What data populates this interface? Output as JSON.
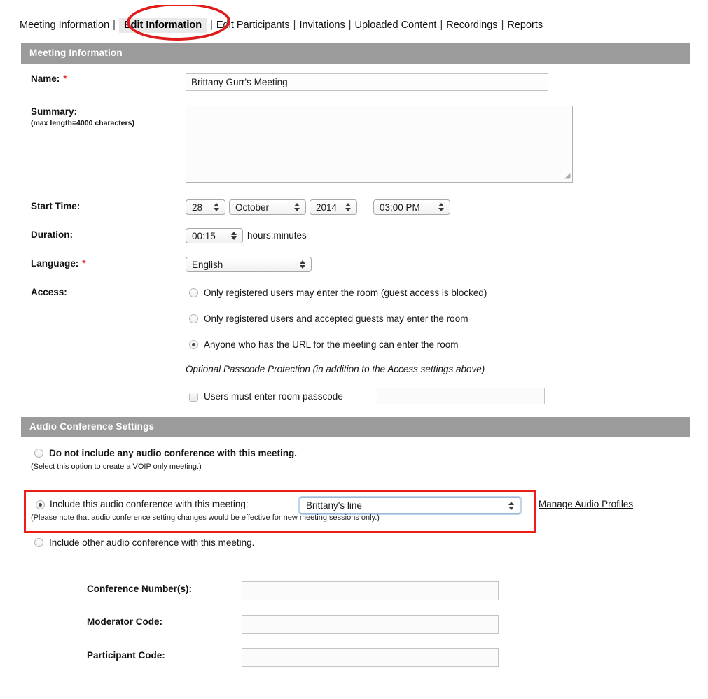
{
  "nav": {
    "separator": "|",
    "tabs": [
      {
        "label": "Meeting Information",
        "active": false
      },
      {
        "label": "Edit Information",
        "active": true
      },
      {
        "label": "Edit Participants",
        "active": false
      },
      {
        "label": "Invitations",
        "active": false
      },
      {
        "label": "Uploaded Content",
        "active": false
      },
      {
        "label": "Recordings",
        "active": false
      },
      {
        "label": "Reports",
        "active": false
      }
    ]
  },
  "annotations": {
    "ellipse_target": "Edit Information",
    "ellipse_color": "#e01b1b",
    "redbox_color": "#ee1c17",
    "redbox_target": "Include this audio conference with this meeting"
  },
  "colors": {
    "section_bar": "#9b9b9b",
    "section_bar_text": "#ffffff",
    "required_marker": "#e8261c",
    "focus_ring": "#bcd6ee"
  },
  "meeting_information": {
    "section_title": "Meeting Information",
    "name": {
      "label": "Name:",
      "required_marker": "*",
      "value": "Brittany Gurr's Meeting",
      "placeholder": ""
    },
    "summary": {
      "label": "Summary:",
      "sublabel": "(max length=4000 characters)",
      "value": "",
      "placeholder": ""
    },
    "start_time": {
      "label": "Start Time:",
      "day": "28",
      "month": "October",
      "year": "2014",
      "time": "03:00 PM"
    },
    "duration": {
      "label": "Duration:",
      "value": "00:15",
      "units": "hours:minutes"
    },
    "language": {
      "label": "Language:",
      "required_marker": "*",
      "value": "English"
    },
    "access": {
      "label": "Access:",
      "options": [
        {
          "label": "Only registered users may enter the room (guest access is blocked)",
          "selected": false
        },
        {
          "label": "Only registered users and accepted guests may enter the room",
          "selected": false
        },
        {
          "label": "Anyone who has the URL for the meeting can enter the room",
          "selected": true
        }
      ],
      "passcode_heading": "Optional Passcode Protection (in addition to the Access settings above)",
      "passcode_checkbox_label": "Users must enter room passcode",
      "passcode_checked": false,
      "passcode_value": "",
      "passcode_placeholder": ""
    }
  },
  "audio_conference_settings": {
    "section_title": "Audio Conference Settings",
    "options": [
      {
        "label": "Do not include any audio conference with this meeting.",
        "note": "(Select this option to create a VOIP only meeting.)",
        "selected": false
      },
      {
        "label": "Include this audio conference with this meeting:",
        "note": "(Please note that audio conference setting changes would be effective for new meeting sessions only.)",
        "selected": true,
        "profile_value": "Brittany's line",
        "manage_link": "Manage Audio Profiles"
      },
      {
        "label": "Include other audio conference with this meeting.",
        "note": "",
        "selected": false
      }
    ],
    "fields": [
      {
        "label": "Conference Number(s):",
        "value": "",
        "placeholder": ""
      },
      {
        "label": "Moderator Code:",
        "value": "",
        "placeholder": ""
      },
      {
        "label": "Participant Code:",
        "value": "",
        "placeholder": ""
      }
    ]
  }
}
